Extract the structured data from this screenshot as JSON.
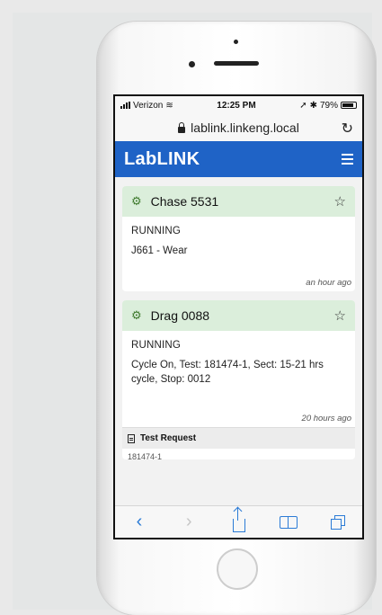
{
  "status_bar": {
    "carrier": "Verizon",
    "time": "12:25 PM",
    "battery": "79%"
  },
  "browser": {
    "url": "lablink.linkeng.local"
  },
  "app": {
    "logo": "LabLINK"
  },
  "cards": [
    {
      "title": "Chase 5531",
      "status": "RUNNING",
      "description": "J661 - Wear",
      "time": "an hour ago"
    },
    {
      "title": "Drag 0088",
      "status": "RUNNING",
      "description": "Cycle On, Test: 181474-1, Sect: 15-21 hrs cycle, Stop: 0012",
      "time": "20 hours ago",
      "section_label": "Test Request",
      "section_text": "181474-1"
    }
  ],
  "toolbar": {
    "back_icon": "chevron-left-icon",
    "forward_icon": "chevron-right-icon",
    "share_icon": "share-icon",
    "bookmarks_icon": "book-icon",
    "tabs_icon": "tabs-icon"
  },
  "colors": {
    "header_blue": "#1f63c6",
    "card_header_green": "#dbeedb",
    "gear_green": "#3f7a2e",
    "ios_blue": "#2b7bd6"
  }
}
